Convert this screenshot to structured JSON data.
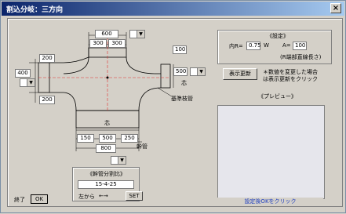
{
  "window": {
    "title": "割込分岐：三方向"
  },
  "dims": {
    "top_width": "600",
    "top_split_left": "300",
    "top_split_right": "300",
    "top_height": "100",
    "left_top": "200",
    "left_mid": "400",
    "left_bottom": "200",
    "right_mid": "500",
    "bottom_left": "150",
    "bottom_mid": "500",
    "bottom_right": "250",
    "bottom_total": "800",
    "center_mark": "芯",
    "right_center_mark": "芯",
    "base_branch": "基準枝管",
    "main_pipe": "幹管"
  },
  "settings": {
    "title": "《設定》",
    "inner_r_label": "内R=",
    "inner_r_value": "0.75",
    "w_label": "W",
    "a_label": "A=",
    "a_value": "100",
    "note": "(R端部直線長さ)"
  },
  "update": {
    "button": "表示更新",
    "note_line1": "＊数値を変更した場合",
    "note_line2": "は表示更新をクリック"
  },
  "preview": {
    "title": "《プレビュー》",
    "status": "設定後OKをクリック"
  },
  "ratio": {
    "title": "《幹管分割比》",
    "value": "15-4-25",
    "from_left": "左から",
    "arrow": "←→",
    "set_button": "SET"
  },
  "footer": {
    "end_label": "終了",
    "ok_button": "OK"
  },
  "colors": {
    "titlebar_start": "#0a246a",
    "preview_bg": "#e6e6ec",
    "status_text": "#2040c0"
  }
}
